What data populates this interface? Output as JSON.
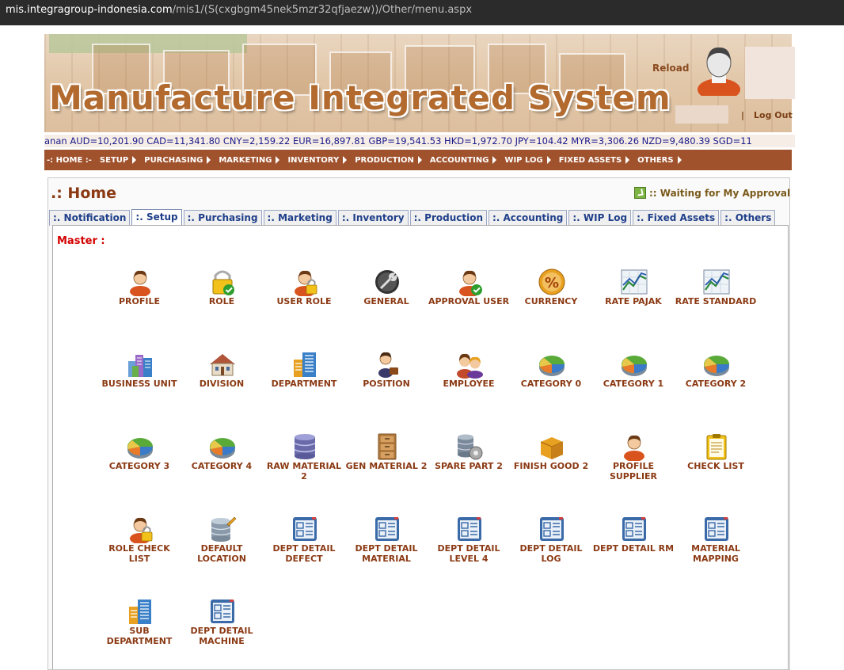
{
  "browser": {
    "url_domain": "mis.integragroup-indonesia.com",
    "url_path": "/mis1/(S(cxgbgm45nek5mzr32qfjaezw))/Other/menu.aspx"
  },
  "banner": {
    "title": "Manufacture Integrated System",
    "reload_label": "Reload",
    "logout_separator": "|",
    "logout_label": "Log Out"
  },
  "ticker": {
    "text": "anan AUD=10,201.90 CAD=11,341.80 CNY=2,159.22 EUR=16,897.81 GBP=19,541.53 HKD=1,972.70 JPY=104.42 MYR=3,306.26 NZD=9,480.39 SGD=11"
  },
  "nav": {
    "items": [
      "-: HOME :-",
      "SETUP",
      "PURCHASING",
      "MARKETING",
      "INVENTORY",
      "PRODUCTION",
      "ACCOUNTING",
      "WIP LOG",
      "FIXED ASSETS",
      "OTHERS"
    ]
  },
  "page": {
    "title": ".: Home",
    "waiting_label": ":: Waiting for My Approval",
    "section_label": "Master :"
  },
  "tabs": [
    ":. Notification",
    ":. Setup",
    ":. Purchasing",
    ":. Marketing",
    ":. Inventory",
    ":. Production",
    ":. Accounting",
    ":. WIP Log",
    ":. Fixed Assets",
    ":. Others"
  ],
  "active_tab": ":. Setup",
  "menu": [
    {
      "label": "PROFILE",
      "icon": "person-icon"
    },
    {
      "label": "ROLE",
      "icon": "padlock-check-icon"
    },
    {
      "label": "USER ROLE",
      "icon": "user-lock-icon"
    },
    {
      "label": "GENERAL",
      "icon": "wrench-icon"
    },
    {
      "label": "APPROVAL USER",
      "icon": "user-check-icon"
    },
    {
      "label": "CURRENCY",
      "icon": "percent-coin-icon"
    },
    {
      "label": "RATE PAJAK",
      "icon": "line-chart-icon"
    },
    {
      "label": "RATE STANDARD",
      "icon": "line-chart-icon"
    },
    {
      "label": "BUSINESS UNIT",
      "icon": "buildings-icon"
    },
    {
      "label": "DIVISION",
      "icon": "house-icon"
    },
    {
      "label": "DEPARTMENT",
      "icon": "building-icon"
    },
    {
      "label": "POSITION",
      "icon": "person-briefcase-icon"
    },
    {
      "label": "EMPLOYEE",
      "icon": "people-icon"
    },
    {
      "label": "CATEGORY 0",
      "icon": "pie-chart-icon"
    },
    {
      "label": "CATEGORY 1",
      "icon": "pie-chart-icon"
    },
    {
      "label": "CATEGORY 2",
      "icon": "pie-chart-icon"
    },
    {
      "label": "CATEGORY 3",
      "icon": "pie-chart-icon"
    },
    {
      "label": "CATEGORY 4",
      "icon": "pie-chart-icon"
    },
    {
      "label": "RAW MATERIAL 2",
      "icon": "database-icon"
    },
    {
      "label": "GEN MATERIAL 2",
      "icon": "cabinet-icon"
    },
    {
      "label": "SPARE PART 2",
      "icon": "database-gear-icon"
    },
    {
      "label": "FINISH GOOD 2",
      "icon": "box-icon"
    },
    {
      "label": "PROFILE SUPPLIER",
      "icon": "person-icon"
    },
    {
      "label": "CHECK LIST",
      "icon": "clipboard-icon"
    },
    {
      "label": "ROLE CHECK LIST",
      "icon": "user-lock-icon"
    },
    {
      "label": "DEFAULT LOCATION",
      "icon": "database-edit-icon"
    },
    {
      "label": "DEPT DETAIL DEFECT",
      "icon": "form-icon"
    },
    {
      "label": "DEPT DETAIL MATERIAL",
      "icon": "form-icon"
    },
    {
      "label": "DEPT DETAIL LEVEL 4",
      "icon": "form-icon"
    },
    {
      "label": "DEPT DETAIL LOG",
      "icon": "form-icon"
    },
    {
      "label": "DEPT DETAIL RM",
      "icon": "form-icon"
    },
    {
      "label": "MATERIAL MAPPING",
      "icon": "form-icon"
    },
    {
      "label": "SUB DEPARTMENT",
      "icon": "building-icon"
    },
    {
      "label": "DEPT DETAIL MACHINE",
      "icon": "form-icon"
    }
  ],
  "colors": {
    "nav_bg": "#a0522d",
    "title": "#8b3a14",
    "section": "#d40000",
    "tab_text": "#1f3f8a",
    "ticker_text": "#1a1a8c"
  }
}
